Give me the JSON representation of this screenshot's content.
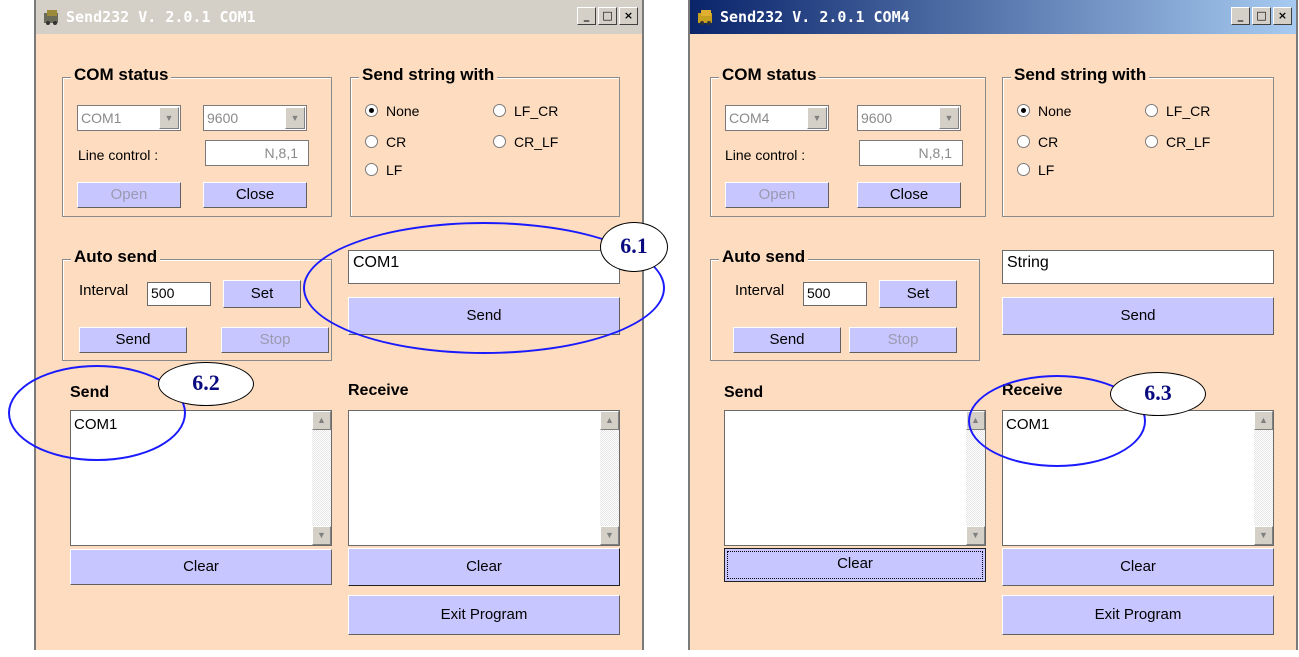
{
  "window1": {
    "title": "Send232 V. 2.0.1 COM1",
    "com_status": {
      "legend": "COM status",
      "port": "COM1",
      "baud": "9600",
      "line_control_label": "Line control :",
      "line_control": "N,8,1",
      "open": "Open",
      "close": "Close"
    },
    "send_string_with": {
      "legend": "Send string with",
      "options": [
        "None",
        "CR",
        "LF",
        "LF_CR",
        "CR_LF"
      ],
      "selected": "None"
    },
    "auto_send": {
      "legend": "Auto send",
      "interval_label": "Interval",
      "interval": "500",
      "set": "Set",
      "send": "Send",
      "stop": "Stop"
    },
    "string_input": "COM1",
    "send_button": "Send",
    "send_section": {
      "label": "Send",
      "text": "COM1",
      "clear": "Clear"
    },
    "receive_section": {
      "label": "Receive",
      "text": "",
      "clear": "Clear"
    },
    "exit": "Exit Program"
  },
  "window2": {
    "title": "Send232 V. 2.0.1 COM4",
    "com_status": {
      "legend": "COM status",
      "port": "COM4",
      "baud": "9600",
      "line_control_label": "Line control :",
      "line_control": "N,8,1",
      "open": "Open",
      "close": "Close"
    },
    "send_string_with": {
      "legend": "Send string with",
      "options": [
        "None",
        "CR",
        "LF",
        "LF_CR",
        "CR_LF"
      ],
      "selected": "None"
    },
    "auto_send": {
      "legend": "Auto send",
      "interval_label": "Interval",
      "interval": "500",
      "set": "Set",
      "send": "Send",
      "stop": "Stop"
    },
    "string_input": "String",
    "send_button": "Send",
    "send_section": {
      "label": "Send",
      "text": "",
      "clear": "Clear"
    },
    "receive_section": {
      "label": "Receive",
      "text": "COM1",
      "clear": "Clear"
    },
    "exit": "Exit Program"
  },
  "callouts": [
    "6.1",
    "6.2",
    "6.3"
  ],
  "window_controls": {
    "minimize": "_",
    "maximize": "□",
    "close": "×"
  },
  "colors": {
    "window_bg": "#fddcc0",
    "button_bg": "#c8c6ff",
    "callout_ring": "#1a1aff",
    "active_title": "#0a246a"
  }
}
